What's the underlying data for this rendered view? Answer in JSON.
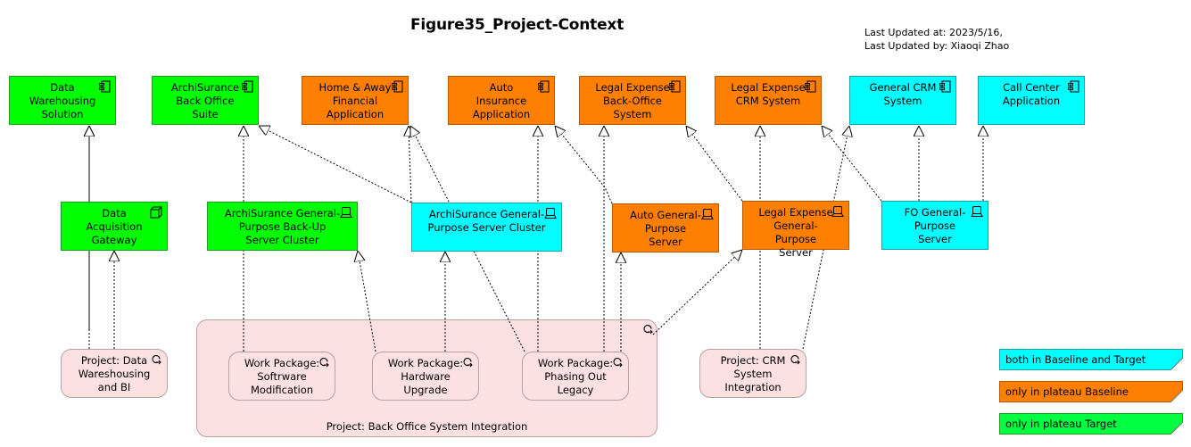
{
  "header": {
    "title": "Figure35_Project-Context",
    "last_updated_at": "Last Updated at: 2023/5/16,",
    "last_updated_by": "Last Updated by: Xiaoqi Zhao"
  },
  "applications": [
    {
      "id": "dws",
      "label": "Data Warehousing Solution",
      "status": "target",
      "icon": "application-component-icon"
    },
    {
      "id": "abos",
      "label": "ArchiSurance Back Office Suite",
      "status": "target",
      "icon": "application-component-icon"
    },
    {
      "id": "haf",
      "label": "Home & Away Financial Application",
      "status": "baseline",
      "icon": "application-component-icon"
    },
    {
      "id": "aia",
      "label": "Auto Insurance Application",
      "status": "baseline",
      "icon": "application-component-icon"
    },
    {
      "id": "lebo",
      "label": "Legal Expense Back-Office System",
      "status": "baseline",
      "icon": "application-component-icon"
    },
    {
      "id": "lecrm",
      "label": "Legal Expense CRM System",
      "status": "baseline",
      "icon": "application-component-icon"
    },
    {
      "id": "gcrm",
      "label": "General CRM System",
      "status": "both",
      "icon": "application-component-icon"
    },
    {
      "id": "cca",
      "label": "Call Center Application",
      "status": "both",
      "icon": "application-component-icon"
    }
  ],
  "infrastructure": [
    {
      "id": "dag",
      "label": "Data Acquisition Gateway",
      "status": "target",
      "icon": "node-icon"
    },
    {
      "id": "agbu",
      "label": "ArchiSurance General-Purpose Back-Up Server Cluster",
      "status": "target",
      "icon": "device-icon"
    },
    {
      "id": "agsc",
      "label": "ArchiSurance General-Purpose Server Cluster",
      "status": "both",
      "icon": "device-icon"
    },
    {
      "id": "ags",
      "label": "Auto General-Purpose Server",
      "status": "baseline",
      "icon": "device-icon"
    },
    {
      "id": "legs",
      "label": "Legal Expense General-Purpose Server",
      "status": "baseline",
      "icon": "device-icon"
    },
    {
      "id": "fogs",
      "label": "FO General-Purpose Server",
      "status": "both",
      "icon": "device-icon"
    }
  ],
  "projects": [
    {
      "id": "pdw",
      "label": "Project: Data Wareshousing and BI",
      "icon": "work-package-icon"
    },
    {
      "id": "pcrm",
      "label": "Project: CRM System Integration",
      "icon": "work-package-icon"
    }
  ],
  "project_group": {
    "id": "pbosi",
    "label": "Project: Back Office System Integration",
    "icon": "work-package-icon",
    "work_packages": [
      {
        "id": "wpsm",
        "label": "Work Package: Softrware Modification"
      },
      {
        "id": "wphu",
        "label": "Work Package: Hardware Upgrade"
      },
      {
        "id": "wppo",
        "label": "Work Package: Phasing Out Legacy"
      }
    ]
  },
  "relationships": [
    {
      "from": "dag",
      "to": "dws",
      "type": "realization"
    },
    {
      "from": "pdw",
      "to": "dws",
      "type": "realization"
    },
    {
      "from": "pdw",
      "to": "dag",
      "type": "realization"
    },
    {
      "from": "wpsm",
      "to": "abos",
      "type": "realization"
    },
    {
      "from": "agsc",
      "to": "abos",
      "type": "realization"
    },
    {
      "from": "wphu",
      "to": "agbu",
      "type": "realization"
    },
    {
      "from": "wphu",
      "to": "agsc",
      "type": "realization"
    },
    {
      "from": "agsc",
      "to": "haf",
      "type": "realization"
    },
    {
      "from": "wppo",
      "to": "haf",
      "type": "realization"
    },
    {
      "from": "wppo",
      "to": "aia",
      "type": "realization"
    },
    {
      "from": "ags",
      "to": "aia",
      "type": "realization"
    },
    {
      "from": "wppo",
      "to": "lebo",
      "type": "realization"
    },
    {
      "from": "legs",
      "to": "lebo",
      "type": "realization"
    },
    {
      "from": "wppo",
      "to": "ags",
      "type": "realization"
    },
    {
      "from": "pbosi",
      "to": "legs",
      "type": "realization"
    },
    {
      "from": "pcrm",
      "to": "lecrm",
      "type": "realization"
    },
    {
      "from": "fogs",
      "to": "lecrm",
      "type": "realization"
    },
    {
      "from": "pcrm",
      "to": "gcrm",
      "type": "realization"
    },
    {
      "from": "fogs",
      "to": "gcrm",
      "type": "realization"
    },
    {
      "from": "fogs",
      "to": "cca",
      "type": "realization"
    }
  ],
  "legend": [
    {
      "label": "both in Baseline and Target",
      "color": "#00ffff"
    },
    {
      "label": "only in plateau Baseline",
      "color": "#ff8000"
    },
    {
      "label": "only in plateau Target",
      "color": "#00ff00"
    }
  ],
  "colors": {
    "target": "#00ff00",
    "baseline": "#ff8000",
    "both": "#00ffff",
    "work_package": "#fde0e1"
  }
}
